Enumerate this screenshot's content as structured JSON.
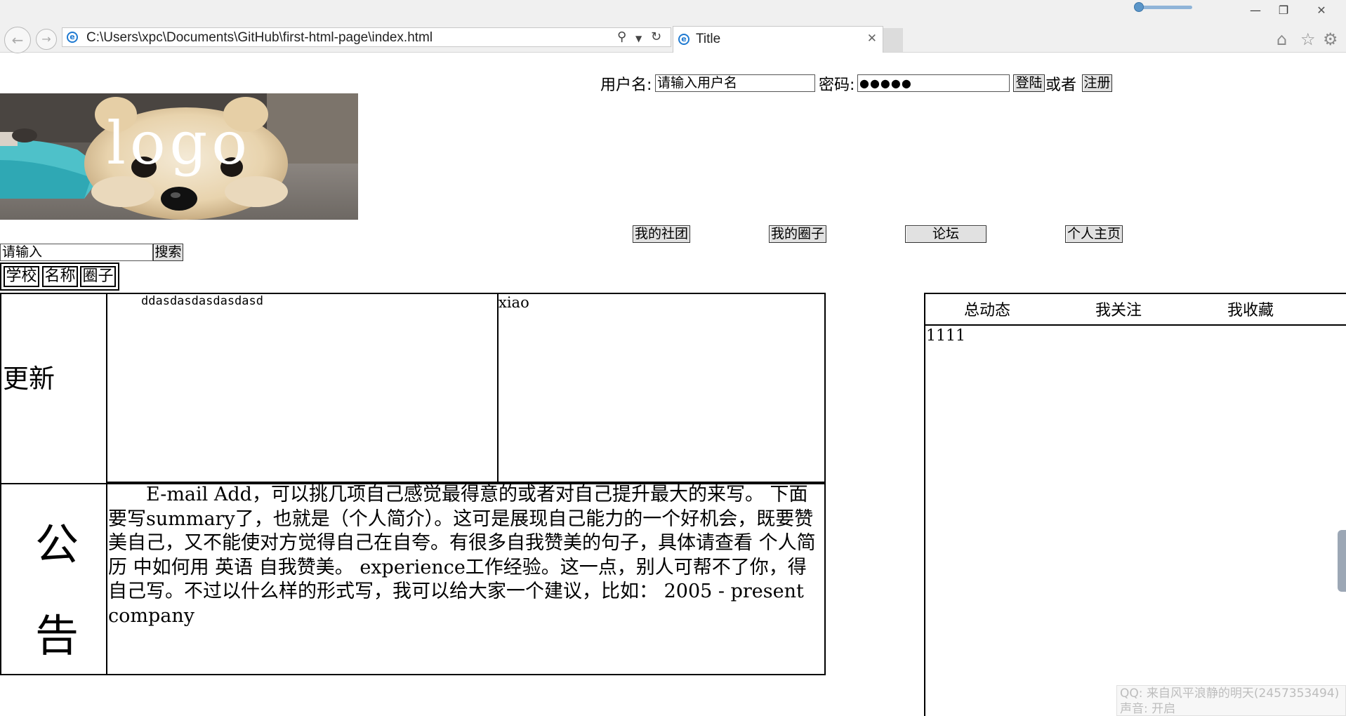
{
  "browser": {
    "address_url": "C:\\Users\\xpc\\Documents\\GitHub\\first-html-page\\index.html",
    "tab_title": "Title",
    "window_buttons": {
      "minimize": "—",
      "restore": "❐",
      "close": "✕"
    }
  },
  "login": {
    "username_label": "用户名:",
    "username_value": "请输入用户名",
    "password_label": "密码:",
    "password_value": "●●●●●",
    "login_button": "登陆",
    "or_text": "或者",
    "register_button": "注册"
  },
  "logo": {
    "text": "logo"
  },
  "nav": {
    "items": [
      "我的社团",
      "我的圈子",
      "论坛",
      "个人主页"
    ]
  },
  "search": {
    "input_value": "请输入",
    "button": "搜索",
    "filters": [
      "学校",
      "名称",
      "圈子"
    ]
  },
  "update": {
    "label": "更新",
    "cell1": "ddasdasdasdasdasd",
    "cell2": "xiao"
  },
  "announce": {
    "label_line1": "公",
    "label_line2": "告",
    "text": "　　E-mail Add，可以挑几项自己感觉最得意的或者对自己提升最大的来写。 下面要写summary了，也就是（个人简介）。这可是展现自己能力的一个好机会，既要赞美自己，又不能使对方觉得自己在自夸。有很多自我赞美的句子，具体请查看 个人简历 中如何用 英语 自我赞美。 experience工作经验。这一点，别人可帮不了你，得自己写。不过以什么样的形式写，我可以给大家一个建议，比如： 2005 - present company"
  },
  "feed": {
    "tabs": [
      "总动态",
      "我关注",
      "我收藏"
    ],
    "content": "1111"
  },
  "overlay": {
    "line1": "QQ: 来自风平浪静的明天(2457353494)",
    "line2": "声音: 开启"
  }
}
